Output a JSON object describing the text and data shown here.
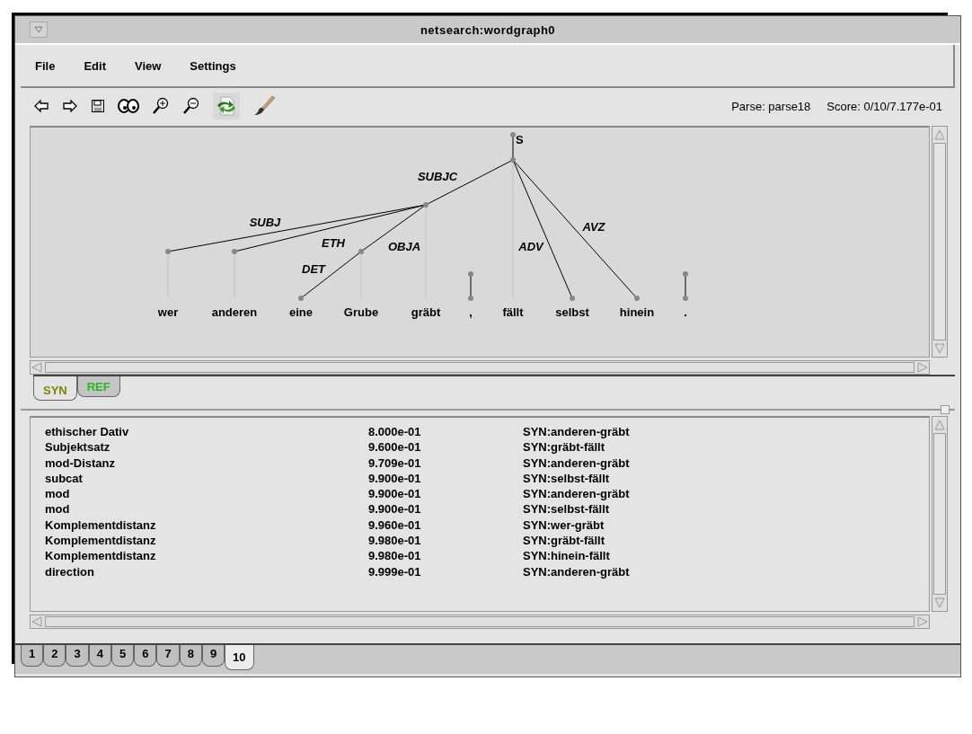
{
  "window": {
    "title": "netsearch:wordgraph0"
  },
  "menu": [
    "File",
    "Edit",
    "View",
    "Settings"
  ],
  "toolbar": {
    "parse": "Parse: parse18",
    "score": "Score: 0/10/7.177e-01"
  },
  "graph": {
    "root_label": "S",
    "words": [
      {
        "text": "wer",
        "kind": "dependent",
        "label": "SUBJ"
      },
      {
        "text": "anderen",
        "kind": "dependent",
        "label": "ETH"
      },
      {
        "text": "eine",
        "kind": "dependent",
        "label": "DET"
      },
      {
        "text": "Grube",
        "kind": "dependent",
        "label": "OBJA"
      },
      {
        "text": "gräbt",
        "kind": "dependent",
        "label": "SUBJC"
      },
      {
        "text": ",",
        "kind": "punctuation"
      },
      {
        "text": "fällt",
        "kind": "root"
      },
      {
        "text": "selbst",
        "kind": "dependent",
        "label": "ADV"
      },
      {
        "text": "hinein",
        "kind": "dependent",
        "label": "AVZ"
      },
      {
        "text": ".",
        "kind": "punctuation"
      }
    ]
  },
  "view_tabs": [
    {
      "label": "SYN",
      "selected": true,
      "color": "#7a8a00"
    },
    {
      "label": "REF",
      "selected": false,
      "color": "#22bb22"
    }
  ],
  "constraints": [
    {
      "name": "ethischer Dativ",
      "score": "8.000e-01",
      "edge": "SYN:anderen-gräbt"
    },
    {
      "name": "Subjektsatz",
      "score": "9.600e-01",
      "edge": "SYN:gräbt-fällt"
    },
    {
      "name": "mod-Distanz",
      "score": "9.709e-01",
      "edge": "SYN:anderen-gräbt"
    },
    {
      "name": "subcat",
      "score": "9.900e-01",
      "edge": "SYN:selbst-fällt"
    },
    {
      "name": "mod",
      "score": "9.900e-01",
      "edge": "SYN:anderen-gräbt"
    },
    {
      "name": "mod",
      "score": "9.900e-01",
      "edge": "SYN:selbst-fällt"
    },
    {
      "name": "Komplementdistanz",
      "score": "9.960e-01",
      "edge": "SYN:wer-gräbt"
    },
    {
      "name": "Komplementdistanz",
      "score": "9.980e-01",
      "edge": "SYN:gräbt-fällt"
    },
    {
      "name": "Komplementdistanz",
      "score": "9.980e-01",
      "edge": "SYN:hinein-fällt"
    },
    {
      "name": "direction",
      "score": "9.999e-01",
      "edge": "SYN:anderen-gräbt"
    }
  ],
  "page_tabs": [
    {
      "label": "1",
      "selected": false
    },
    {
      "label": "2",
      "selected": false
    },
    {
      "label": "3",
      "selected": false
    },
    {
      "label": "4",
      "selected": false
    },
    {
      "label": "5",
      "selected": false
    },
    {
      "label": "6",
      "selected": false
    },
    {
      "label": "7",
      "selected": false
    },
    {
      "label": "8",
      "selected": false
    },
    {
      "label": "9",
      "selected": false
    },
    {
      "label": "10",
      "selected": true
    }
  ]
}
